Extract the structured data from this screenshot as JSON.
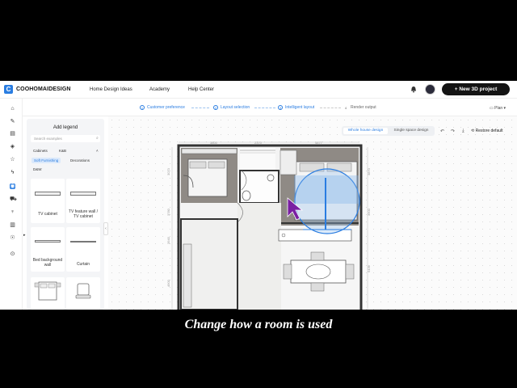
{
  "app": {
    "logo_letter": "C",
    "name": "COOHOMAIDESIGN"
  },
  "nav": {
    "items": [
      "Home Design Ideas",
      "Academy",
      "Help Center"
    ],
    "new_project_label": "+ New 3D project"
  },
  "steps": [
    {
      "num": "1",
      "label": "Customer preference"
    },
    {
      "num": "2",
      "label": "Layout selection"
    },
    {
      "num": "3",
      "label": "Intelligent layout"
    },
    {
      "num": "4",
      "label": "Render output"
    }
  ],
  "plan_select": "Plan",
  "legend_panel": {
    "title": "Add legend",
    "search_placeholder": "Search examples",
    "categories": [
      "Cabinets",
      "K&B"
    ],
    "chips": [
      "Soft Furnishing",
      "Decorations"
    ],
    "active_chip": "Soft Furnishing",
    "dw_label": "D&W",
    "items": [
      "TV cabinet",
      "TV feature wall / TV cabinet",
      "Bed background wall",
      "Curtain"
    ]
  },
  "design_toggle": {
    "options": [
      "Whole house design",
      "Single space design"
    ],
    "selected": "Whole house design"
  },
  "toolbar": {
    "restore_label": "Restore default"
  },
  "floorplan": {
    "top_dims": [
      "3800",
      "2370",
      "4877"
    ],
    "left_dims": [
      "3070",
      "3780",
      "3940",
      "4900"
    ],
    "right_dims": [
      "3870",
      "3900",
      "5436"
    ]
  },
  "colors": {
    "accent": "#2a7de1",
    "cursor": "#7a1fa2",
    "highlight": "#9cc4ef"
  },
  "subtitle": "Change how a room is used"
}
